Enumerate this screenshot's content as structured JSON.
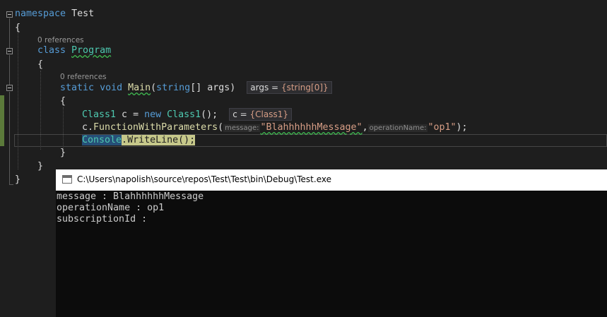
{
  "code": {
    "namespace_kw": "namespace",
    "namespace_name": "Test",
    "open_brace": "{",
    "close_brace": "}",
    "class_refs": "0 references",
    "class_kw": "class",
    "class_name": "Program",
    "method_refs": "0 references",
    "static_kw": "static",
    "void_kw": "void",
    "method_name": "Main",
    "method_open": "(",
    "string_kw": "string",
    "array_brackets": "[]",
    "args_name": "args",
    "method_close": ")",
    "args_tip_label": "args = ",
    "args_tip_value": "{string[0]}",
    "class1_type": "Class1",
    "var_c": " c = ",
    "new_kw": "new",
    "class1_ctor": "Class1",
    "ctor_tail": "();",
    "c_tip_label": "c = ",
    "c_tip_value": "{Class1}",
    "call_prefix": "c.",
    "call_method": "FunctionWithParameters",
    "call_open": "(",
    "hint_message": "message:",
    "arg_message": "\"BlahhhhhhMessage\"",
    "comma": ",",
    "hint_operation": "operationName:",
    "arg_operation": "\"op1\"",
    "call_close": ");",
    "console_type": "Console",
    "dot": ".",
    "writeline": "WriteLine",
    "writeline_tail": "();"
  },
  "console_window": {
    "title": "C:\\Users\\napolish\\source\\repos\\Test\\Test\\bin\\Debug\\Test.exe",
    "lines": [
      "message : BlahhhhhhMessage",
      "operationName : op1",
      "subscriptionId :"
    ]
  },
  "colors": {
    "editor_bg": "#1e1e1e",
    "keyword": "#569cd6",
    "type": "#4ec9b0",
    "method": "#dcdcaa",
    "string": "#d69d85",
    "console_bg": "#0c0c0c"
  }
}
